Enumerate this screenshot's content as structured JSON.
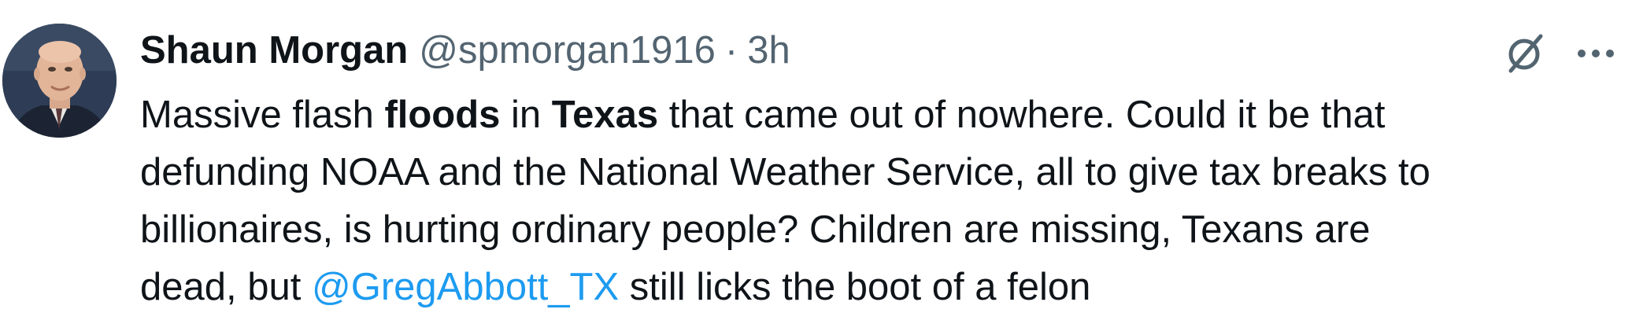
{
  "tweet": {
    "display_name": "Shaun Morgan",
    "handle": "@spmorgan1916",
    "separator": "·",
    "time": "3h",
    "body": {
      "line1": {
        "seg1": "Massive flash ",
        "seg2_bold": "floods",
        "seg3": " in ",
        "seg4_bold": "Texas",
        "seg5": " that came out of nowhere.  Could it be that"
      },
      "line2": "defunding NOAA and the National Weather Service, all to give tax breaks to",
      "line3": "billionaires, is hurting ordinary people? Children are missing, Texans are",
      "line4": {
        "seg1": "dead, but ",
        "mention": "@GregAbbott_TX",
        "seg2": " still licks the boot of a felon"
      }
    }
  },
  "icons": {
    "grok": "grok-icon",
    "more": "more-icon"
  },
  "colors": {
    "text": "#0f1419",
    "secondary": "#536471",
    "link": "#1d9bf0",
    "background": "#ffffff"
  }
}
